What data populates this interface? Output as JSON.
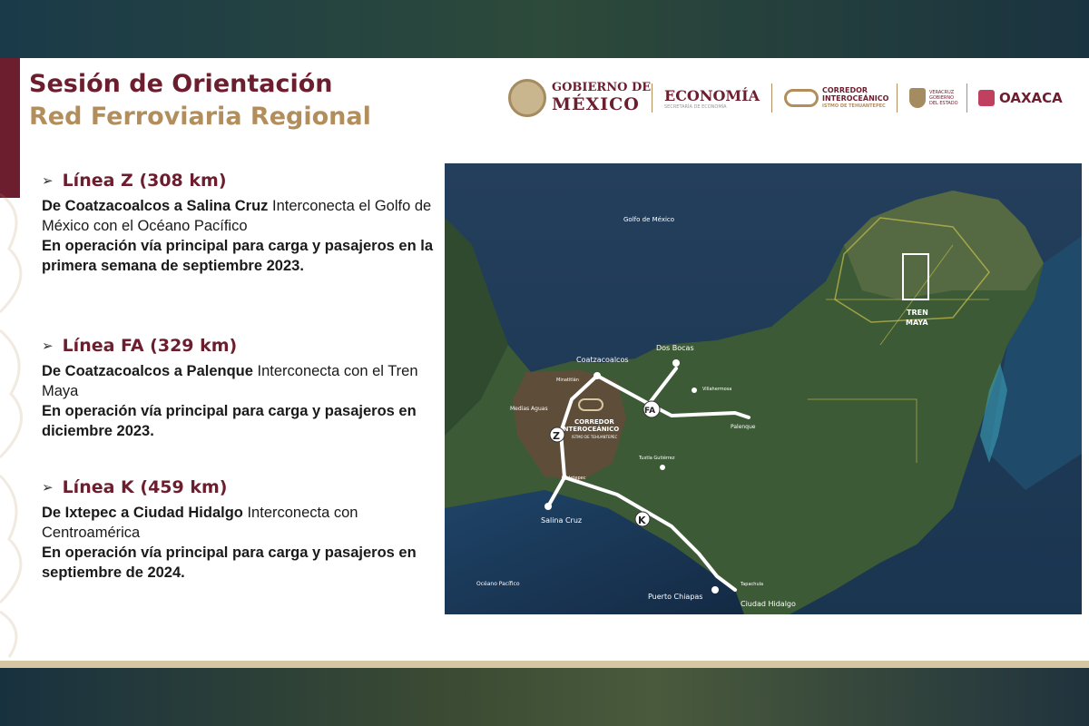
{
  "header": {
    "title": "Sesión de Orientación",
    "subtitle": "Red Ferroviaria Regional"
  },
  "logos": {
    "gobierno_top": "GOBIERNO DE",
    "gobierno_bottom": "MÉXICO",
    "economia": "ECONOMÍA",
    "economia_sub": "SECRETARÍA DE ECONOMÍA",
    "corredor_line1": "CORREDOR",
    "corredor_line2": "INTEROCEÁNICO",
    "corredor_line3": "ISTMO DE TEHUANTEPEC",
    "veracruz_line1": "VERACRUZ",
    "veracruz_line2": "GOBIERNO",
    "veracruz_line3": "DEL ESTADO",
    "oaxaca": "OAXACA"
  },
  "lines": [
    {
      "heading": "Línea Z (308 km)",
      "route": "De Coatzacoalcos a Salina Cruz",
      "description": " Interconecta el Golfo de México con el Océano Pacífico",
      "status": "En operación vía principal para carga y pasajeros en la primera semana de septiembre 2023."
    },
    {
      "heading": "Línea FA (329 km)",
      "route": "De Coatzacoalcos a Palenque",
      "description": " Interconecta con el Tren Maya",
      "status": "En operación vía principal para carga y pasajeros en diciembre 2023."
    },
    {
      "heading": "Línea K (459 km)",
      "route": "De Ixtepec a Ciudad Hidalgo",
      "description": " Interconecta con Centroamérica",
      "status": "En operación vía principal para carga y pasajeros en septiembre de 2024."
    }
  ],
  "map": {
    "gulf_label": "Golfo de México",
    "pacific_label": "Océano Pacífico",
    "tren_maya_line1": "TREN",
    "tren_maya_line2": "MAYA",
    "corredor_line1": "CORREDOR",
    "corredor_line2": "INTEROCEÁNICO",
    "corredor_line3": "ISTMO DE TEHUANTEPEC",
    "cities": {
      "coatzacoalcos": "Coatzacoalcos",
      "dos_bocas": "Dos Bocas",
      "minatitlan": "Minatitlán",
      "villahermosa": "Villahermosa",
      "medias_aguas": "Medias Aguas",
      "palenque": "Palenque",
      "tuxtla": "Tuxtla Gutiérrez",
      "ixtepec": "Ixtepec",
      "salina_cruz": "Salina Cruz",
      "tapachula": "Tapachula",
      "puerto_chiapas": "Puerto Chiapas",
      "ciudad_hidalgo": "Ciudad Hidalgo"
    },
    "line_markers": {
      "z": "Z",
      "fa": "FA",
      "k": "K"
    }
  },
  "colors": {
    "primary": "#6c1e2f",
    "gold": "#b38e5d"
  }
}
